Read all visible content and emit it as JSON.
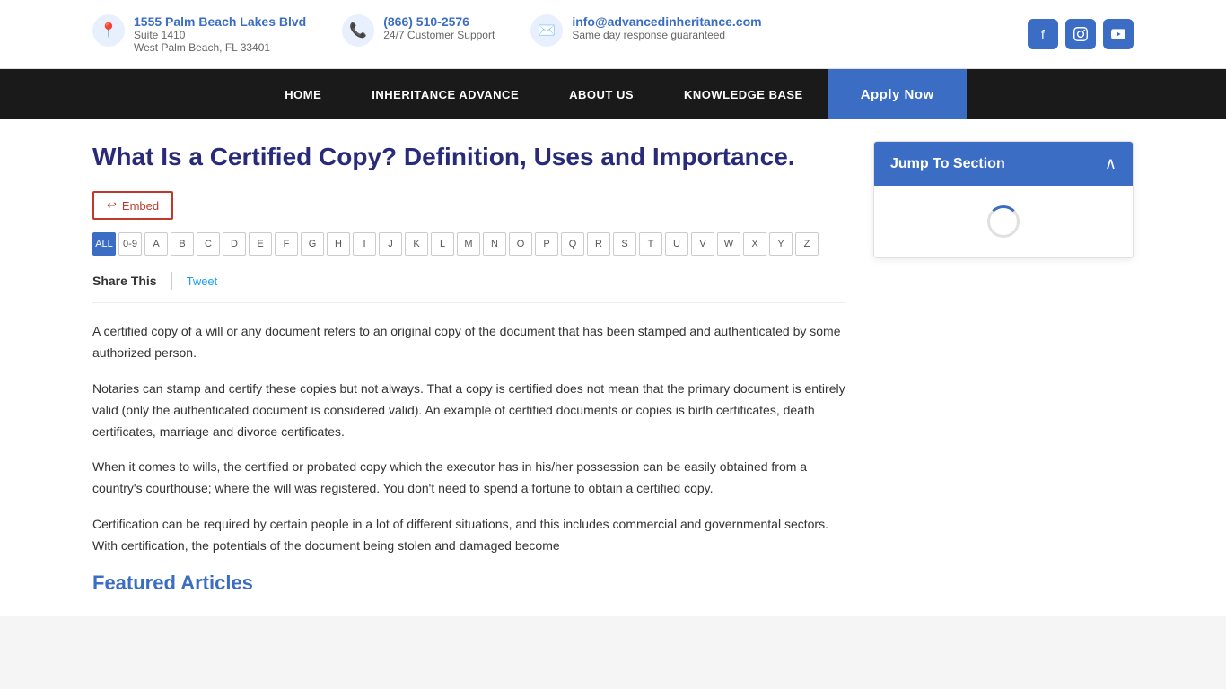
{
  "header": {
    "address": {
      "line1": "1555 Palm Beach Lakes Blvd",
      "line2": "Suite 1410",
      "line3": "West Palm Beach, FL 33401"
    },
    "phone": {
      "number": "(866) 510-2576",
      "support": "24/7 Customer Support"
    },
    "email": {
      "address": "info@advancedinheritance.com",
      "note": "Same day response guaranteed"
    },
    "social": {
      "facebook": "f",
      "instagram": "📷",
      "youtube": "▶"
    }
  },
  "nav": {
    "items": [
      {
        "label": "HOME",
        "id": "home"
      },
      {
        "label": "INHERITANCE ADVANCE",
        "id": "inheritance-advance"
      },
      {
        "label": "ABOUT US",
        "id": "about-us"
      },
      {
        "label": "KNOWLEDGE BASE",
        "id": "knowledge-base"
      }
    ],
    "cta": "Apply Now"
  },
  "page": {
    "title": "What Is a Certified Copy? Definition, Uses and Importance.",
    "embed_label": "Embed",
    "share_label": "Share This",
    "tweet_label": "Tweet",
    "alphabet": [
      "ALL",
      "0-9",
      "A",
      "B",
      "C",
      "D",
      "E",
      "F",
      "G",
      "H",
      "I",
      "J",
      "K",
      "L",
      "M",
      "N",
      "O",
      "P",
      "Q",
      "R",
      "S",
      "T",
      "U",
      "V",
      "W",
      "X",
      "Y",
      "Z"
    ],
    "paragraphs": [
      "A  certified copy of a will or any document refers to an original copy of the document that has been stamped and authenticated by some authorized person.",
      "Notaries can stamp and certify these copies but not always. That a copy is certified does not mean that the primary document is entirely valid (only the authenticated document is considered valid).  An example of certified documents or copies is birth certificates, death certificates, marriage and divorce certificates.",
      "When it comes to wills, the certified or probated copy which the executor has in his/her possession can be easily obtained from a country's courthouse; where the will was registered. You don't need to spend a fortune to obtain a certified copy.",
      "Certification can be required by certain people in a lot of different situations, and this includes commercial and governmental sectors. With certification, the potentials of the document being stolen and damaged become"
    ],
    "featured_heading": "Featured Articles"
  },
  "sidebar": {
    "jump_to_section": "Jump To Section"
  }
}
